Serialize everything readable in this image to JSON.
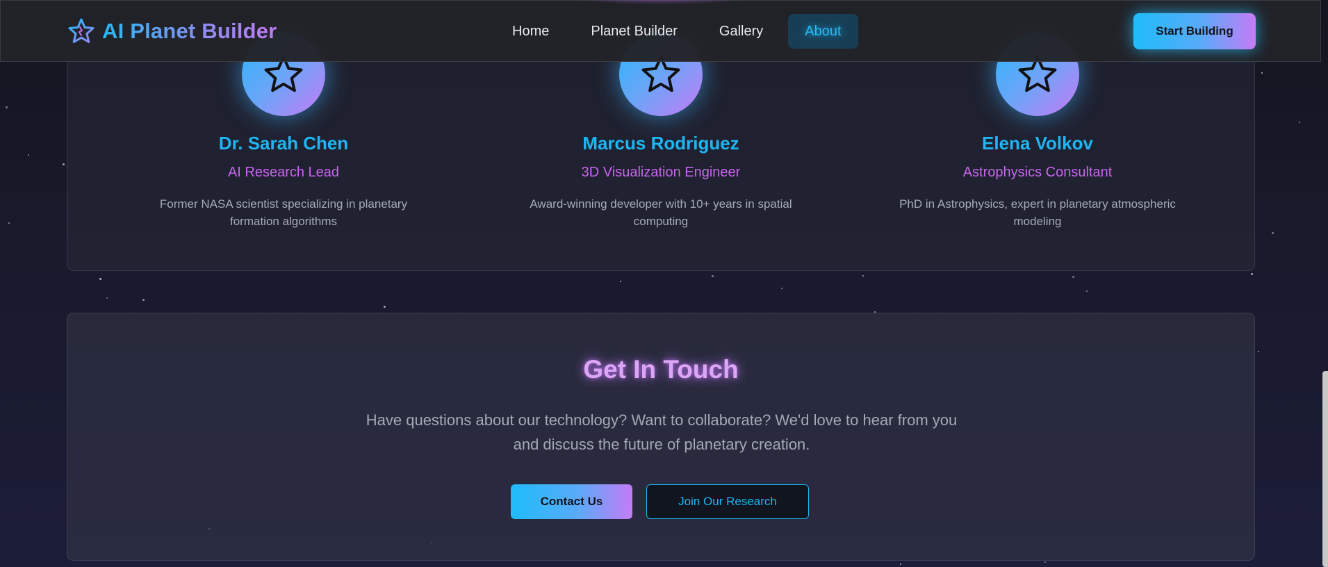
{
  "nav": {
    "brand": "AI Planet Builder",
    "links": [
      {
        "label": "Home",
        "active": false
      },
      {
        "label": "Planet Builder",
        "active": false
      },
      {
        "label": "Gallery",
        "active": false
      },
      {
        "label": "About",
        "active": true
      }
    ],
    "cta_label": "Start Building"
  },
  "team": [
    {
      "name": "Dr. Sarah Chen",
      "role": "AI Research Lead",
      "bio": "Former NASA scientist specializing in planetary formation algorithms",
      "icon": "star-icon"
    },
    {
      "name": "Marcus Rodriguez",
      "role": "3D Visualization Engineer",
      "bio": "Award-winning developer with 10+ years in spatial computing",
      "icon": "star-icon"
    },
    {
      "name": "Elena Volkov",
      "role": "Astrophysics Consultant",
      "bio": "PhD in Astrophysics, expert in planetary atmospheric modeling",
      "icon": "star-icon"
    }
  ],
  "contact": {
    "title": "Get In Touch",
    "text": "Have questions about our technology? Want to collaborate? We'd love to hear from you and discuss the future of planetary creation.",
    "primary_label": "Contact Us",
    "secondary_label": "Join Our Research"
  },
  "colors": {
    "accent_cyan": "#1eb6f2",
    "accent_purple": "#c865ef",
    "title_glow": "#dca6f6",
    "nav_active_bg": "#183e55",
    "background": "#191a2c"
  }
}
